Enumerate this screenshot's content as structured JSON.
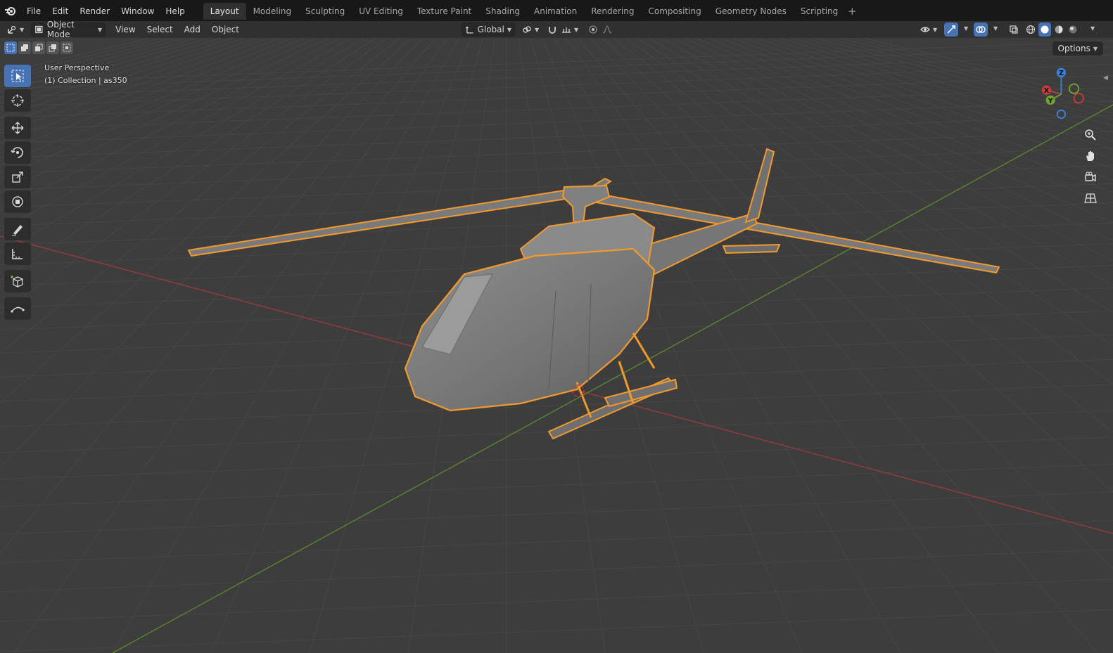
{
  "menu": [
    "File",
    "Edit",
    "Render",
    "Window",
    "Help"
  ],
  "workspaces": [
    {
      "label": "Layout",
      "active": true
    },
    {
      "label": "Modeling",
      "active": false
    },
    {
      "label": "Sculpting",
      "active": false
    },
    {
      "label": "UV Editing",
      "active": false
    },
    {
      "label": "Texture Paint",
      "active": false
    },
    {
      "label": "Shading",
      "active": false
    },
    {
      "label": "Animation",
      "active": false
    },
    {
      "label": "Rendering",
      "active": false
    },
    {
      "label": "Compositing",
      "active": false
    },
    {
      "label": "Geometry Nodes",
      "active": false
    },
    {
      "label": "Scripting",
      "active": false
    }
  ],
  "workspace_add": "+",
  "header": {
    "mode": "Object Mode",
    "view_menu": [
      "View",
      "Select",
      "Add",
      "Object"
    ],
    "transform_orientation": "Global"
  },
  "options_label": "Options",
  "viewport": {
    "perspective_label": "User Perspective",
    "collection_label": "(1) Collection | as350"
  },
  "gizmo": {
    "axis_z": "Z",
    "axis_x": "X",
    "axis_y": "Y"
  },
  "colors": {
    "accent": "#4772b3",
    "selection_outline": "#f29a2e",
    "x_axis": "#c73b3b",
    "y_axis": "#6fa232",
    "z_axis": "#3b7fd6"
  },
  "tools": [
    "select-box-icon",
    "cursor-icon",
    "move-icon",
    "rotate-icon",
    "scale-icon",
    "transform-icon",
    "annotate-icon",
    "measure-icon",
    "add-cube-icon",
    "extrude-curve-icon"
  ]
}
